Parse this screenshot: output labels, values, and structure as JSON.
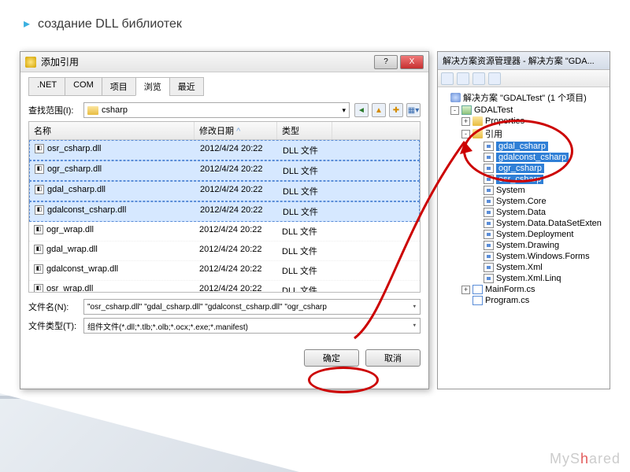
{
  "slide": {
    "title": "создание DLL библиотек"
  },
  "dialog": {
    "title": "添加引用",
    "win_buttons": {
      "help": "?",
      "close": "X"
    },
    "tabs": [
      ".NET",
      "COM",
      "项目",
      "浏览",
      "最近"
    ],
    "active_tab": 3,
    "lookIn_label": "查找范围(I):",
    "lookIn_value": "csharp",
    "columns": {
      "name": "名称",
      "date": "修改日期",
      "type": "类型"
    },
    "files": [
      {
        "name": "osr_csharp.dll",
        "date": "2012/4/24 20:22",
        "type": "DLL 文件",
        "selected": true
      },
      {
        "name": "ogr_csharp.dll",
        "date": "2012/4/24 20:22",
        "type": "DLL 文件",
        "selected": true
      },
      {
        "name": "gdal_csharp.dll",
        "date": "2012/4/24 20:22",
        "type": "DLL 文件",
        "selected": true
      },
      {
        "name": "gdalconst_csharp.dll",
        "date": "2012/4/24 20:22",
        "type": "DLL 文件",
        "selected": true
      },
      {
        "name": "ogr_wrap.dll",
        "date": "2012/4/24 20:22",
        "type": "DLL 文件",
        "selected": false
      },
      {
        "name": "gdal_wrap.dll",
        "date": "2012/4/24 20:22",
        "type": "DLL 文件",
        "selected": false
      },
      {
        "name": "gdalconst_wrap.dll",
        "date": "2012/4/24 20:22",
        "type": "DLL 文件",
        "selected": false
      },
      {
        "name": "osr_wrap.dll",
        "date": "2012/4/24 20:22",
        "type": "DLL 文件",
        "selected": false
      }
    ],
    "fileName_label": "文件名(N):",
    "fileName_value": "\"osr_csharp.dll\" \"gdal_csharp.dll\" \"gdalconst_csharp.dll\" \"ogr_csharp",
    "fileType_label": "文件类型(T):",
    "fileType_value": "组件文件(*.dll;*.tlb;*.olb;*.ocx;*.exe;*.manifest)",
    "ok": "确定",
    "cancel": "取消"
  },
  "solution": {
    "title": "解决方案资源管理器 - 解决方案 \"GDA...",
    "root": "解决方案 \"GDALTest\" (1 个项目)",
    "project": "GDALTest",
    "folders": {
      "properties": "Properties",
      "references": "引用"
    },
    "refs_highlighted": [
      "gdal_csharp",
      "gdalconst_csharp",
      "ogr_csharp",
      "osr_csharp"
    ],
    "refs_other": [
      "System",
      "System.Core",
      "System.Data",
      "System.Data.DataSetExten",
      "System.Deployment",
      "System.Drawing",
      "System.Windows.Forms",
      "System.Xml",
      "System.Xml.Linq"
    ],
    "files_cs": [
      "MainForm.cs",
      "Program.cs"
    ]
  },
  "watermark": {
    "a": "MyS",
    "b": "h",
    "c": "ared"
  }
}
